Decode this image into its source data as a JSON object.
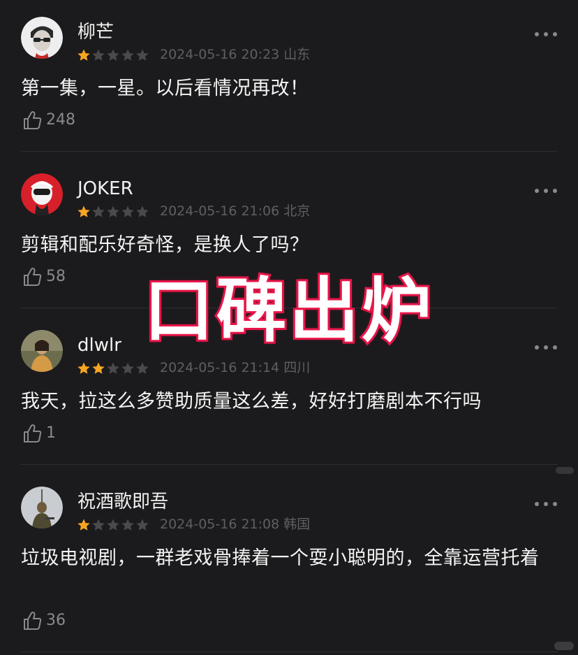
{
  "comments": [
    {
      "username": "柳芒",
      "rating": 1,
      "meta": "2024-05-16 20:23 山东",
      "content": "第一集，一星。以后看情况再改！",
      "likes": "248",
      "avatar_icon": "avatar-person-glasses"
    },
    {
      "username": "JOKER",
      "rating": 1,
      "meta": "2024-05-16 21:06 北京",
      "content": "剪辑和配乐好奇怪，是换人了吗？",
      "likes": "58",
      "avatar_icon": "avatar-red-helmet"
    },
    {
      "username": "dlwlr",
      "rating": 2,
      "meta": "2024-05-16 21:14 四川",
      "content": "我天，拉这么多赞助质量这么差，好好打磨剧本不行吗",
      "likes": "1",
      "avatar_icon": "avatar-photo-person"
    },
    {
      "username": "祝酒歌即吾",
      "rating": 1,
      "meta": "2024-05-16 21:08 韩国",
      "content": "垃圾电视剧，一群老戏骨捧着一个耍小聪明的，全靠运营托着",
      "likes": "36",
      "avatar_icon": "avatar-photo-soldier"
    }
  ],
  "overlay": {
    "text": "口碑出炉",
    "fill_color": "#ffffff",
    "stroke_color": "#e8174a"
  },
  "colors": {
    "background": "#1b1b1d",
    "star_active": "#f5a623",
    "star_inactive": "#4a4a4d",
    "meta_text": "#5f5f63"
  }
}
